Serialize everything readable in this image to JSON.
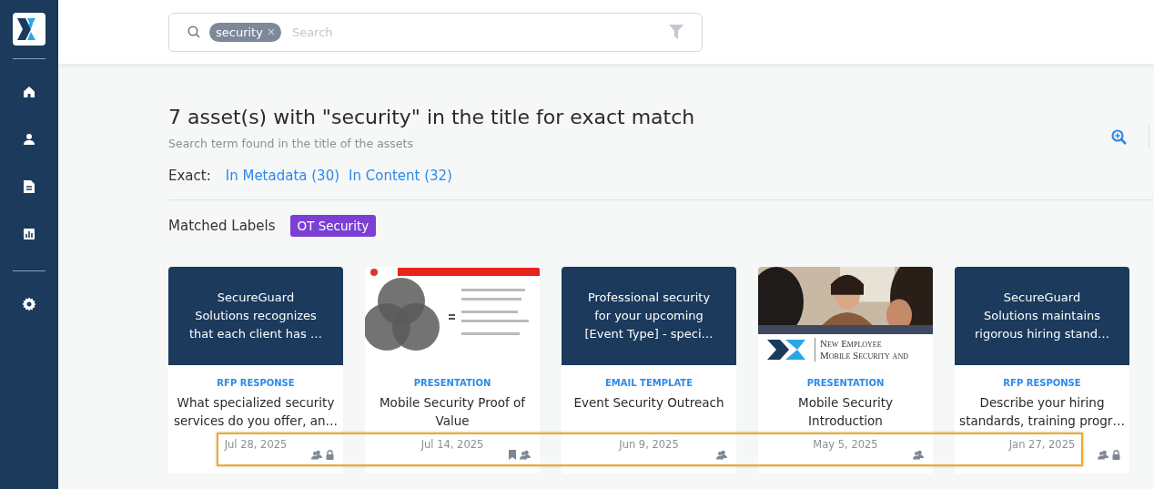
{
  "sidebar": {
    "items": [
      {
        "kind": "home",
        "selected": false
      },
      {
        "kind": "person",
        "selected": false
      },
      {
        "kind": "document",
        "selected": false
      },
      {
        "kind": "chart",
        "selected": false
      },
      {
        "kind": "settings",
        "selected": false
      }
    ]
  },
  "search": {
    "chips": [
      "security"
    ],
    "placeholder": "Search"
  },
  "results": {
    "heading": "7 asset(s) with \"security\" in the title for exact match",
    "subtitle": "Search term found in the title of the assets",
    "exact_label": "Exact:",
    "exact_links": [
      "In Metadata (30)",
      "In Content (32)"
    ],
    "labels_title": "Matched Labels",
    "labels": [
      {
        "text": "OT Security",
        "color": "#7b3fd4"
      }
    ]
  },
  "cards": [
    {
      "thumb": {
        "kind": "text",
        "lines": [
          "SecureGuard",
          "Solutions recognizes",
          "that each client has …"
        ]
      },
      "type": "RFP RESPONSE",
      "title": [
        "What specialized security",
        "services do you offer, an…"
      ],
      "date": "Jul 28, 2025",
      "icons": [
        {
          "kind": "shared"
        },
        {
          "kind": "lock"
        }
      ]
    },
    {
      "thumb": {
        "kind": "slide"
      },
      "type": "PRESENTATION",
      "title": [
        "Mobile Security Proof of",
        "Value"
      ],
      "date": "Jul 14, 2025",
      "icons": [
        {
          "kind": "bookmark"
        },
        {
          "kind": "shared"
        }
      ]
    },
    {
      "thumb": {
        "kind": "text",
        "lines": [
          "Professional security",
          "for your upcoming",
          "[Event Type] - speci…"
        ]
      },
      "type": "EMAIL TEMPLATE",
      "title": [
        "Event Security Outreach"
      ],
      "date": "Jun 9, 2025",
      "icons": [
        {
          "kind": "shared"
        }
      ]
    },
    {
      "thumb": {
        "lines": [
          "New Employee",
          "Mobile Security and"
        ]
      },
      "type": "PRESENTATION",
      "title": [
        "Mobile Security",
        "Introduction"
      ],
      "date": "May 5, 2025",
      "icons": [
        {
          "kind": "shared"
        }
      ]
    },
    {
      "thumb": {
        "kind": "text",
        "lines": [
          "SecureGuard",
          "Solutions maintains",
          "rigorous hiring stand…"
        ]
      },
      "type": "RFP RESPONSE",
      "title": [
        "Describe your hiring",
        "standards, training progr…"
      ],
      "date": "Jan 27, 2025",
      "icons": [
        {
          "kind": "shared"
        },
        {
          "kind": "lock"
        }
      ]
    }
  ]
}
